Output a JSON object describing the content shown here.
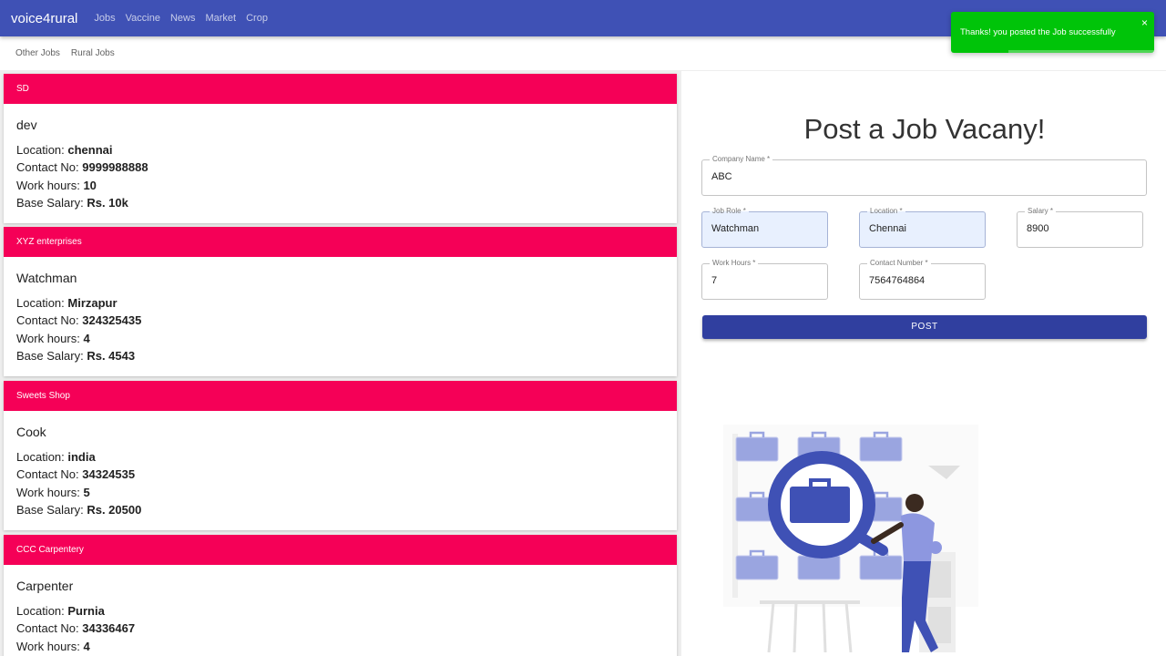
{
  "navbar": {
    "brand": "voice4rural",
    "links": [
      "Jobs",
      "Vaccine",
      "News",
      "Market",
      "Crop"
    ]
  },
  "subnav": {
    "links": [
      "Other Jobs",
      "Rural Jobs"
    ]
  },
  "labels": {
    "location": "Location: ",
    "contact": "Contact No: ",
    "hours": "Work hours: ",
    "salary": "Base Salary: "
  },
  "jobs": [
    {
      "company": "SD",
      "role": "dev",
      "location": "chennai",
      "contact": "9999988888",
      "hours": "10",
      "salary": "Rs. 10k"
    },
    {
      "company": "XYZ enterprises",
      "role": "Watchman",
      "location": "Mirzapur",
      "contact": "324325435",
      "hours": "4",
      "salary": "Rs. 4543"
    },
    {
      "company": "Sweets Shop",
      "role": "Cook",
      "location": "india",
      "contact": "34324535",
      "hours": "5",
      "salary": "Rs. 20500"
    },
    {
      "company": "CCC Carpentery",
      "role": "Carpenter",
      "location": "Purnia",
      "contact": "34336467",
      "hours": "4",
      "salary": ""
    }
  ],
  "form": {
    "title": "Post a Job Vacany!",
    "company_name": {
      "label": "Company Name *",
      "value": "ABC"
    },
    "job_role": {
      "label": "Job Role *",
      "value": "Watchman"
    },
    "location": {
      "label": "Location *",
      "value": "Chennai"
    },
    "salary": {
      "label": "Salary *",
      "value": "8900"
    },
    "work_hours": {
      "label": "Work Hours *",
      "value": "7"
    },
    "contact_number": {
      "label": "Contact Number *",
      "value": "7564764864"
    },
    "submit_label": "POST"
  },
  "toast": {
    "message": "Thanks! you posted the Job successfully",
    "close": "×",
    "color": "#00c409"
  },
  "colors": {
    "primary": "#3f51b5",
    "accent": "#f50057",
    "button": "#303f9f"
  }
}
